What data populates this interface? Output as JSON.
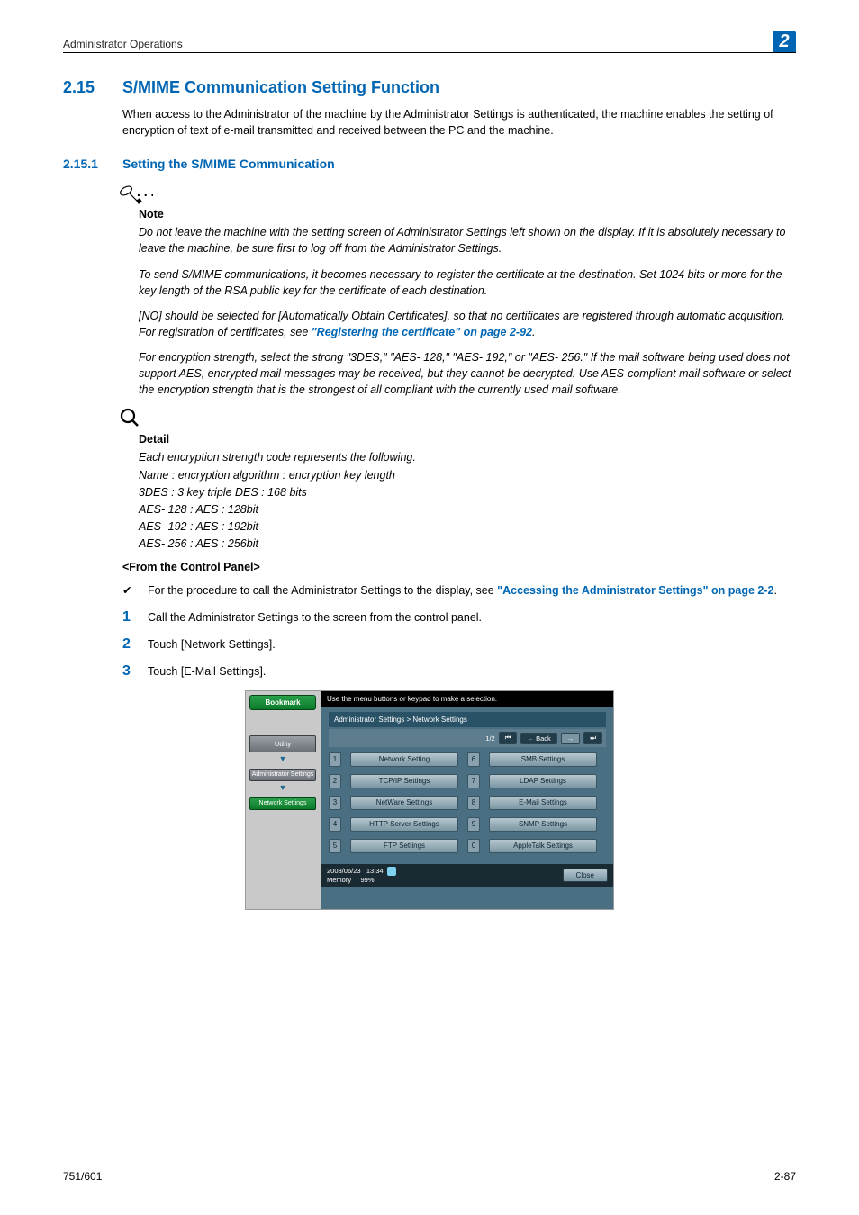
{
  "header": {
    "title": "Administrator Operations",
    "chapter": "2"
  },
  "sec": {
    "num": "2.15",
    "title": "S/MIME Communication Setting Function",
    "intro": "When access to the Administrator of the machine by the Administrator Settings is authenticated, the machine enables the setting of encryption of text of e-mail transmitted and received between the PC and the machine."
  },
  "sub": {
    "num": "2.15.1",
    "title": "Setting the S/MIME Communication"
  },
  "note": {
    "label": "Note",
    "p1": "Do not leave the machine with the setting screen of Administrator Settings left shown on the display. If it is absolutely necessary to leave the machine, be sure first to log off from the Administrator Settings.",
    "p2": "To send S/MIME communications, it becomes necessary to register the certificate at the destination. Set 1024 bits or more for the key length of the RSA public key for the certificate of each destination.",
    "p3a": "[NO] should be selected for [Automatically Obtain Certificates], so that no certificates are registered through automatic acquisition. For registration of certificates, see ",
    "p3link": "\"Registering the certificate\" on page 2-92",
    "p3b": ".",
    "p4": "For encryption strength, select the strong \"3DES,\" \"AES- 128,\" \"AES- 192,\" or \"AES- 256.\" If the mail software being used does not support AES, encrypted mail messages may be received, but they cannot be decrypted. Use AES-compliant mail software or select the encryption strength that is the strongest of all compliant with the currently used mail software."
  },
  "detail": {
    "label": "Detail",
    "l1": "Each encryption strength code represents the following.",
    "l2": "Name : encryption algorithm : encryption key length",
    "l3": "3DES : 3 key triple DES : 168 bits",
    "l4": "AES- 128 : AES : 128bit",
    "l5": "AES- 192 : AES : 192bit",
    "l6": "AES- 256 : AES : 256bit"
  },
  "from": "<From the Control Panel>",
  "check": {
    "pre": "For the procedure to call the Administrator Settings to the display, see ",
    "link": "\"Accessing the Administrator Settings\" on page 2-2",
    "post": "."
  },
  "steps": {
    "s1": "Call the Administrator Settings to the screen from the control panel.",
    "s2": "Touch [Network Settings].",
    "s3": "Touch [E-Mail Settings]."
  },
  "shot": {
    "instr": "Use the menu buttons or keypad to make a selection.",
    "crumb": "Administrator Settings > Network Settings",
    "page": "1/2",
    "back": "Back",
    "bookmark": "Bookmark",
    "side": {
      "utility": "Utility",
      "admin": "Administrator Settings",
      "net": "Network Settings"
    },
    "opts": [
      {
        "n": "1",
        "label": "Network Setting"
      },
      {
        "n": "2",
        "label": "TCP/IP Settings"
      },
      {
        "n": "3",
        "label": "NetWare Settings"
      },
      {
        "n": "4",
        "label": "HTTP Server Settings"
      },
      {
        "n": "5",
        "label": "FTP Settings"
      },
      {
        "n": "6",
        "label": "SMB Settings"
      },
      {
        "n": "7",
        "label": "LDAP Settings"
      },
      {
        "n": "8",
        "label": "E-Mail Settings"
      },
      {
        "n": "9",
        "label": "SNMP Settings"
      },
      {
        "n": "0",
        "label": "AppleTalk Settings"
      }
    ],
    "status": {
      "date": "2008/06/23",
      "time": "13:34",
      "memlabel": "Memory",
      "mem": "99%"
    },
    "close": "Close"
  },
  "footer": {
    "left": "751/601",
    "right": "2-87"
  }
}
